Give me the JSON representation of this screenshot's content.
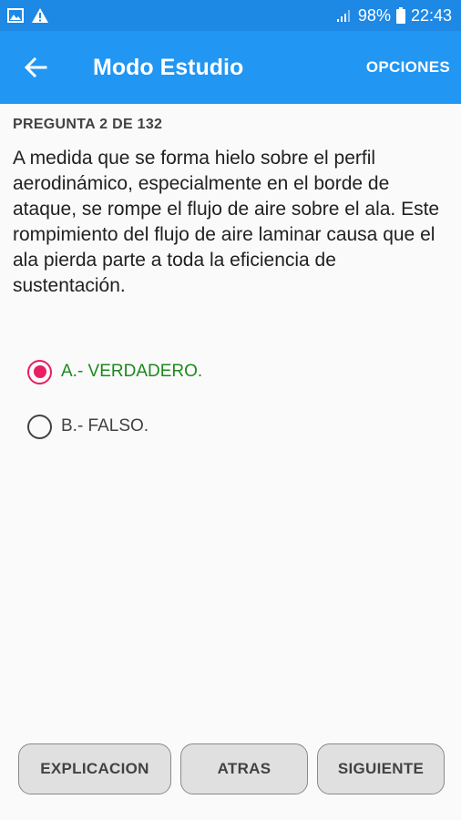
{
  "status_bar": {
    "battery": "98%",
    "time": "22:43",
    "icons": [
      "image-icon",
      "warning-icon",
      "signal-icon",
      "battery-icon"
    ]
  },
  "app_bar": {
    "title": "Modo Estudio",
    "options_label": "OPCIONES",
    "back_icon": "arrow-back-icon",
    "background": "#2196f3"
  },
  "question": {
    "counter": "PREGUNTA 2 DE 132",
    "text": "A medida que se forma hielo sobre el perfil aerodinámico, especialmente en el borde de ataque, se rompe el flujo de aire sobre el ala. Este rompimiento del flujo de aire laminar causa que el ala pierda parte a toda la eficiencia de sustentación."
  },
  "options": [
    {
      "label": "A.- VERDADERO.",
      "selected": true,
      "color": "#1b8a1b"
    },
    {
      "label": "B.- FALSO.",
      "selected": false,
      "color": "#424242"
    }
  ],
  "buttons": {
    "explanation": "EXPLICACION",
    "back": "ATRAS",
    "next": "SIGUIENTE"
  },
  "accent_color": "#e91e63"
}
